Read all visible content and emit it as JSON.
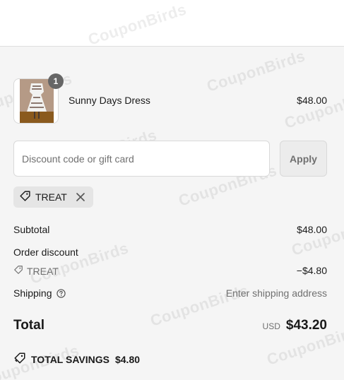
{
  "line_items": [
    {
      "name": "Sunny Days Dress",
      "price": "$48.00",
      "quantity": "1",
      "image_icon": "dress-thumbnail"
    }
  ],
  "discount": {
    "placeholder": "Discount code or gift card",
    "value": "",
    "apply_label": "Apply",
    "applied_code": "TREAT"
  },
  "summary": {
    "subtotal_label": "Subtotal",
    "subtotal_value": "$48.00",
    "order_discount_label": "Order discount",
    "discount_code": "TREAT",
    "discount_value": "−$4.80",
    "shipping_label": "Shipping",
    "shipping_value": "Enter shipping address",
    "total_label": "Total",
    "total_currency": "USD",
    "total_value": "$43.20",
    "savings_label": "TOTAL SAVINGS",
    "savings_value": "$4.80"
  },
  "watermark": "CouponBirds",
  "colors": {
    "panel_bg": "#f5f5f5",
    "badge_bg": "#666666",
    "chip_bg": "#e5e5e5",
    "muted_text": "#707070"
  }
}
